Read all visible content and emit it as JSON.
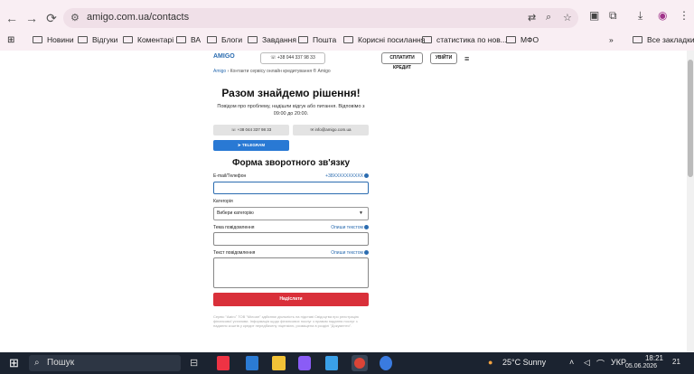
{
  "browser": {
    "url": "amigo.com.ua/contacts",
    "bookmarks": [
      "Новини",
      "Відгуки",
      "Коментарі",
      "ВА",
      "Блоги",
      "Завдання",
      "Пошта",
      "Корисні посилання",
      "статистика по нов...",
      "МФО"
    ],
    "all_bookmarks": "Все закладки",
    "overflow": "»"
  },
  "site": {
    "logo": "AMIGO",
    "phone": "+38 044 337 98 33",
    "pay_button": "СПЛАТИТИ КРЕДИТ",
    "login_button": "УВІЙТИ",
    "breadcrumb_home": "Amigo",
    "breadcrumb_sep": "›",
    "breadcrumb_current": "Контакти сервісу онлайн кредитування ® Amigo",
    "title": "Разом знайдемо рішення!",
    "subtitle": "Повідом про проблему, надішли відгук або питання. Відповімо з 09:00 до 20:00.",
    "contact_phone": "+38 044 337 98 33",
    "contact_email": "info@amigo.com.ua",
    "telegram": "TELEGRAM",
    "form_title": "Форма зворотного зв'язку",
    "email_label": "E-mail/Телефон",
    "email_hint": "+38XXXXXXXXXX",
    "category_label": "Категорія",
    "category_value": "Вибери категорію",
    "subject_label": "Тема повідомлення",
    "subject_hint": "Опиши текстом",
    "message_label": "Текст повідомлення",
    "message_hint": "Опиши текстом",
    "submit": "Надіслати",
    "legal": "Сервіс \"Амігоˮ ТОВ \"Мілоан\" здійснює діяльність на підставі Свідоцтва про реєстрацію фінансової установи. Інформація щодо фінансових послуг з правом надання послуг з надання коштів у кредит передбачену ліцензією, розміщена в розділі \"Документи\"."
  },
  "taskbar": {
    "search": "Пошук",
    "weather": "25°C  Sunny",
    "lang": "УКР",
    "time": "18:21",
    "date": "05.06.2026",
    "notif": "21"
  }
}
